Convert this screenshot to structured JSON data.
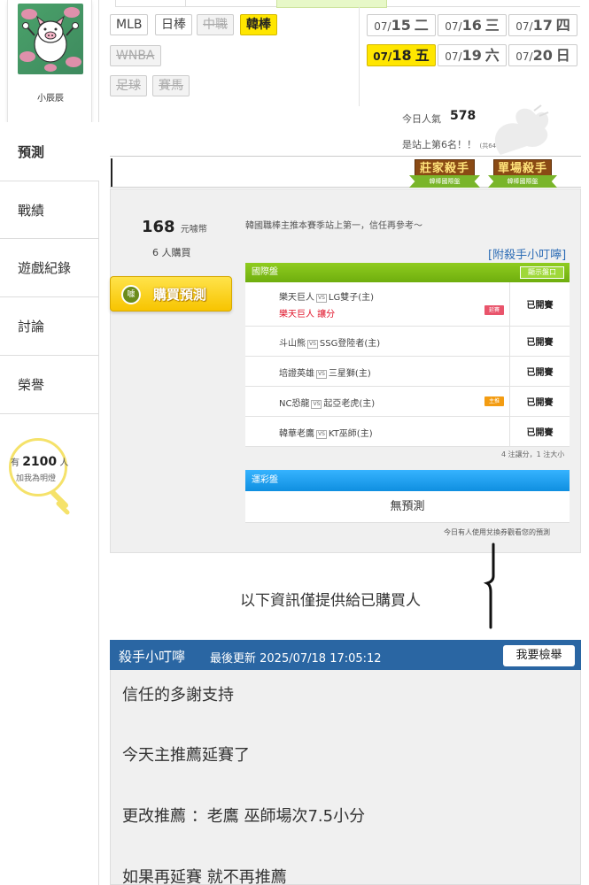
{
  "profile": {
    "username": "小辰辰"
  },
  "sidebar": {
    "items": [
      {
        "label": "預測"
      },
      {
        "label": "戰績"
      },
      {
        "label": "遊戲紀錄"
      },
      {
        "label": "討論"
      },
      {
        "label": "榮譽"
      }
    ],
    "lamp": {
      "prefix": "有",
      "count": "2100",
      "suffix": "人",
      "cta": "加我為明燈"
    }
  },
  "leagues": [
    {
      "label": "MLB"
    },
    {
      "label": "日棒"
    },
    {
      "label": "中職"
    },
    {
      "label": "韓棒"
    },
    {
      "label": "WNBA"
    },
    {
      "label": "足球"
    },
    {
      "label": "賽馬"
    }
  ],
  "dates": [
    {
      "md": "07/",
      "d": "15",
      "w": "二"
    },
    {
      "md": "07/",
      "d": "16",
      "w": "三"
    },
    {
      "md": "07/",
      "d": "17",
      "w": "四"
    },
    {
      "md": "07/",
      "d": "18",
      "w": "五"
    },
    {
      "md": "07/",
      "d": "19",
      "w": "六"
    },
    {
      "md": "07/",
      "d": "20",
      "w": "日"
    }
  ],
  "stats": {
    "popularity_label": "今日人氣",
    "popularity_value": "578",
    "rank_text": "是站上第6名！！",
    "rank_sub": "(共6401人)"
  },
  "badges": {
    "banker": {
      "title": "莊家殺手",
      "sub": "韓棒國際盤"
    },
    "single": {
      "title": "單場殺手",
      "sub": "韓棒國際盤"
    }
  },
  "purchase": {
    "price": "168",
    "price_unit": "元噱幣",
    "buyers": "6 人購買",
    "buy_button": "購買預測",
    "buy_icon": "噱"
  },
  "intro": "韓國職棒主推本賽季站上第一，信任再參考～",
  "tips_link": "[附殺手小叮嚀]",
  "intl_table": {
    "title": "國際盤",
    "show_button": "顯示盤口",
    "vs_label": "VS",
    "rows": [
      {
        "away": "樂天巨人",
        "home": "LG雙子(主)",
        "pick": "樂天巨人  讓分",
        "tag": "延賽",
        "status": "已開賽"
      },
      {
        "away": "斗山熊",
        "home": "SSG登陸者(主)",
        "status": "已開賽"
      },
      {
        "away": "培證英雄",
        "home": "三星獅(主)",
        "status": "已開賽"
      },
      {
        "away": "NC恐龍",
        "home": "起亞老虎(主)",
        "tag": "主推",
        "status": "已開賽"
      },
      {
        "away": "韓華老鷹",
        "home": "KT巫師(主)",
        "status": "已開賽"
      }
    ],
    "note": "4 注讓分，1 注大小"
  },
  "lottery": {
    "title": "運彩盤",
    "empty": "無預測"
  },
  "coupon_note": "今日有人使用兌換券觀看您的預測",
  "buyer_only_note": "以下資訊僅提供給已購買人",
  "tips": {
    "title": "殺手小叮嚀",
    "updated": "最後更新 2025/07/18 17:05:12",
    "report_button": "我要檢舉",
    "lines": [
      "信任的多謝支持",
      "今天主推薦延賽了",
      "更改推薦 ：老鷹 巫師場次7.5小分",
      "如果再延賽 就不再推薦"
    ]
  },
  "colors": {
    "accent_yellow": "#ffe600",
    "header_blue": "#2a66a3",
    "intl_green": "#7cbd16",
    "lottery_blue": "#1f9ff0",
    "pick_red": "#e0142a"
  }
}
